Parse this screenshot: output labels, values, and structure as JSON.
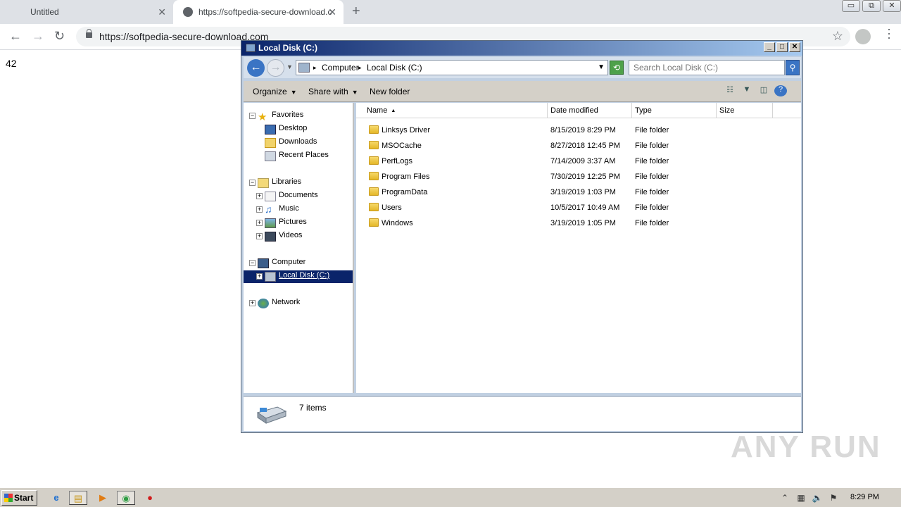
{
  "browser": {
    "tabs": [
      {
        "title": "Untitled",
        "close": "✕"
      },
      {
        "title": "https://softpedia-secure-download.c",
        "close": "✕"
      }
    ],
    "new_tab": "+",
    "window_controls": [
      "▭",
      "⧉",
      "✕"
    ],
    "nav": {
      "back": "←",
      "forward": "→",
      "reload": "↻"
    },
    "url": "https://softpedia-secure-download.com",
    "bookmark_icon": "☆",
    "menu": "⋯"
  },
  "page": {
    "text": "42"
  },
  "explorer": {
    "title": "Local Disk (C:)",
    "title_buttons": [
      "_",
      "□",
      "✕"
    ],
    "breadcrumb": [
      {
        "sep": "▸",
        "label": "Computer"
      },
      {
        "sep": "▸",
        "label": "Local Disk (C:)"
      }
    ],
    "address_dropdown": "▼",
    "back": "←",
    "forward": "→",
    "recent_arrow": "▼",
    "refresh": "⟲",
    "search_placeholder": "Search Local Disk (C:)",
    "search_icon": "⚲",
    "commands": [
      {
        "label": "Organize",
        "caret": "▼"
      },
      {
        "label": "Share with",
        "caret": "▼"
      },
      {
        "label": "New folder",
        "caret": ""
      }
    ],
    "view_icons": [
      "☷",
      "▼",
      "◫",
      "?"
    ],
    "nav_pane": {
      "favorites": {
        "label": "Favorites",
        "expander": "−",
        "children": [
          "Desktop",
          "Downloads",
          "Recent Places"
        ]
      },
      "libraries": {
        "label": "Libraries",
        "expander": "−",
        "children": [
          "Documents",
          "Music",
          "Pictures",
          "Videos"
        ],
        "child_expander": "+"
      },
      "computer": {
        "label": "Computer",
        "expander": "−",
        "children": [
          "Local Disk (C:)"
        ],
        "child_expander": "+"
      },
      "network": {
        "label": "Network",
        "expander": "+"
      }
    },
    "columns": [
      "Name",
      "Date modified",
      "Type",
      "Size"
    ],
    "sort_arrow": "▲",
    "files": [
      {
        "name": "Linksys Driver",
        "date": "8/15/2019 8:29 PM",
        "type": "File folder",
        "size": ""
      },
      {
        "name": "MSOCache",
        "date": "8/27/2018 12:45 PM",
        "type": "File folder",
        "size": ""
      },
      {
        "name": "PerfLogs",
        "date": "7/14/2009 3:37 AM",
        "type": "File folder",
        "size": ""
      },
      {
        "name": "Program Files",
        "date": "7/30/2019 12:25 PM",
        "type": "File folder",
        "size": ""
      },
      {
        "name": "ProgramData",
        "date": "3/19/2019 1:03 PM",
        "type": "File folder",
        "size": ""
      },
      {
        "name": "Users",
        "date": "10/5/2017 10:49 AM",
        "type": "File folder",
        "size": ""
      },
      {
        "name": "Windows",
        "date": "3/19/2019 1:05 PM",
        "type": "File folder",
        "size": ""
      }
    ],
    "status": "7 items"
  },
  "watermark": "ANY RUN",
  "taskbar": {
    "start": "Start",
    "items": [
      "e",
      "▤",
      "▶",
      "◉",
      "●"
    ],
    "tray_icons": [
      "⌃",
      "▦",
      "🔈",
      "⚑"
    ],
    "clock": "8:29 PM"
  },
  "colors": {
    "titlebar": "#0a246a",
    "selection": "#0a246a",
    "taskbar": "#d4d0c8"
  }
}
